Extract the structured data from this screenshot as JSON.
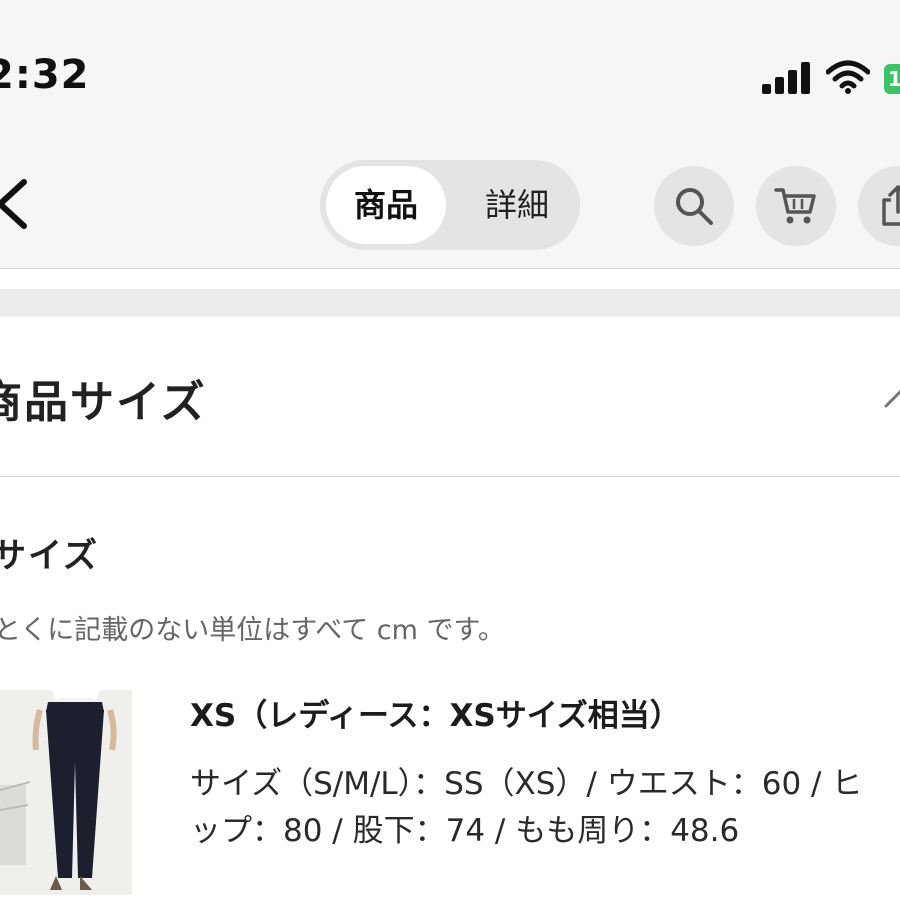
{
  "status_bar": {
    "time": "2:32",
    "battery": "1"
  },
  "nav": {
    "tab_active": "商品",
    "tab_inactive": "詳細"
  },
  "section": {
    "title": "商品サイズ"
  },
  "size": {
    "heading": "サイズ",
    "note": "とくに記載のない単位はすべて cm です。",
    "item": {
      "title": "XS（レディース：XSサイズ相当）",
      "line1": "サイズ（S/M/L）：SS（XS）/ ウエスト：60 / ヒ",
      "line2": "ップ：80 / 股下：74 / もも周り：48.6"
    }
  },
  "colors": {
    "accent_battery": "#3cc36a",
    "pants": "#1b1f2e"
  },
  "icons": [
    "back-chevron-icon",
    "search-icon",
    "cart-icon",
    "share-icon",
    "chevron-up-icon",
    "signal-icon",
    "wifi-icon"
  ]
}
